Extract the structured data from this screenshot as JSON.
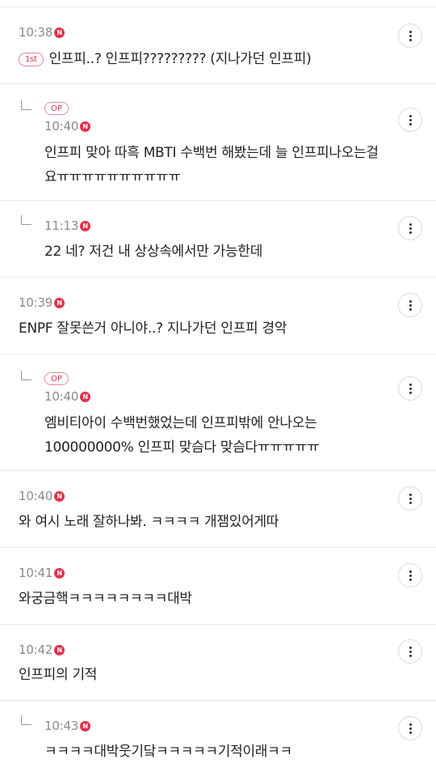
{
  "comments": [
    {
      "time": "10:38",
      "badge": "N",
      "rank": "1st",
      "text": "인프피..? 인프피????????? (지나가던 인프피)"
    },
    {
      "time": "10:40",
      "badge": "N",
      "op": "OP",
      "line1": "인프피 맞아 따흑 MBTI 수백번 해봤는데 늘 인프피나오는걸",
      "line2": "요ㅠㅠㅠㅠㅠㅠㅠㅠㅠㅠ"
    },
    {
      "time": "11:13",
      "badge": "N",
      "text": "22 네? 저건 내 상상속에서만 가능한데"
    },
    {
      "time": "10:39",
      "badge": "N",
      "text": "ENPF 잘못쓴거 아니야..? 지나가던 인프피 경악"
    },
    {
      "time": "10:40",
      "badge": "N",
      "op": "OP",
      "line1": "엠비티아이 수백번했었는데 인프피밖에 안나오는",
      "line2": "100000000% 인프피 맞슴다 맞슴다ㅠㅠㅠㅠㅠ"
    },
    {
      "time": "10:40",
      "badge": "N",
      "text": "와 여시 노래 잘하나봐. ㅋㅋㅋㅋ 개잼있어게따"
    },
    {
      "time": "10:41",
      "badge": "N",
      "text": "와궁금핵ㅋㅋㅋㅋㅋㅋㅋㅋ대박"
    },
    {
      "time": "10:42",
      "badge": "N",
      "text": "인프피의 기적"
    },
    {
      "time": "10:43",
      "badge": "N",
      "text": "ㅋㅋㅋㅋ대박웃기닼ㅋㅋㅋㅋㅋ기적이래ㅋㅋ"
    }
  ]
}
